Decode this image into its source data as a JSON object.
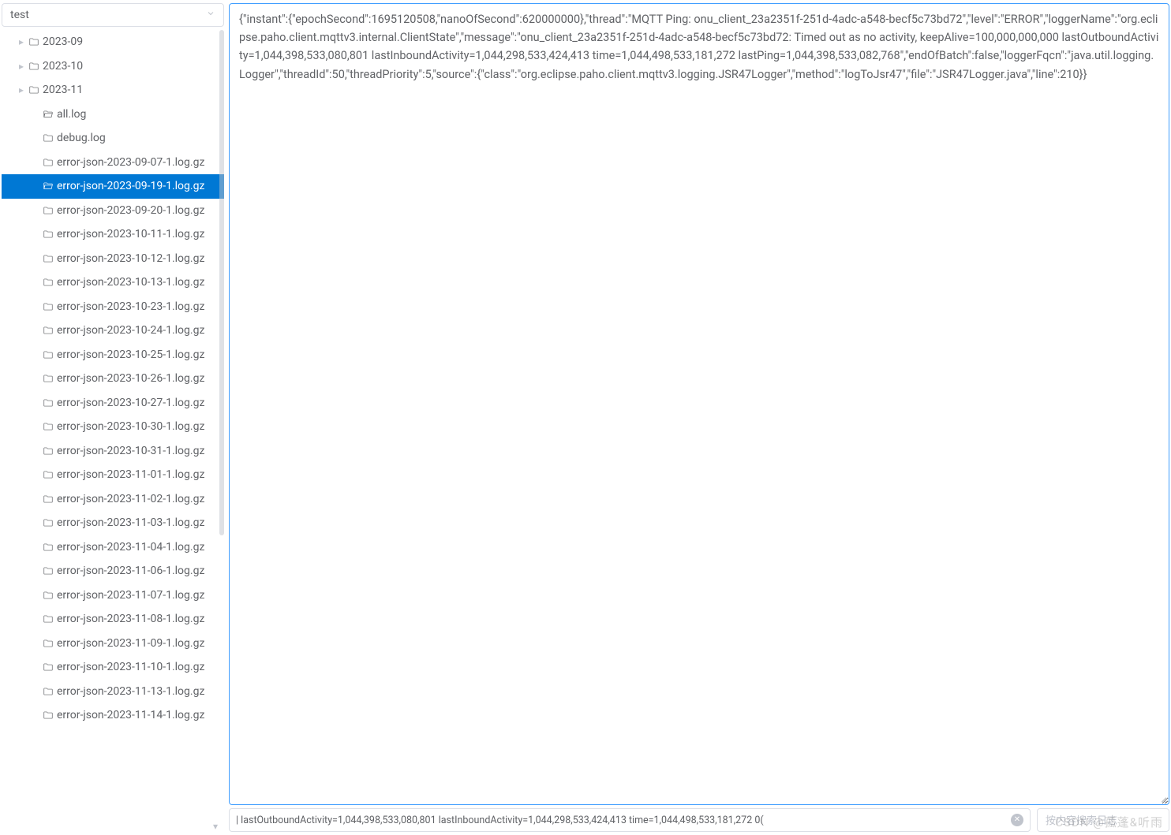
{
  "sidebar": {
    "select_value": "test",
    "folders": [
      {
        "label": "2023-09",
        "expandable": true
      },
      {
        "label": "2023-10",
        "expandable": true
      },
      {
        "label": "2023-11",
        "expandable": true
      }
    ],
    "files": [
      {
        "label": "all.log",
        "open": true
      },
      {
        "label": "debug.log",
        "open": false
      },
      {
        "label": "error-json-2023-09-07-1.log.gz",
        "open": false
      },
      {
        "label": "error-json-2023-09-19-1.log.gz",
        "open": true,
        "selected": true
      },
      {
        "label": "error-json-2023-09-20-1.log.gz",
        "open": false
      },
      {
        "label": "error-json-2023-10-11-1.log.gz",
        "open": false
      },
      {
        "label": "error-json-2023-10-12-1.log.gz",
        "open": false
      },
      {
        "label": "error-json-2023-10-13-1.log.gz",
        "open": false
      },
      {
        "label": "error-json-2023-10-23-1.log.gz",
        "open": false
      },
      {
        "label": "error-json-2023-10-24-1.log.gz",
        "open": false
      },
      {
        "label": "error-json-2023-10-25-1.log.gz",
        "open": false
      },
      {
        "label": "error-json-2023-10-26-1.log.gz",
        "open": false
      },
      {
        "label": "error-json-2023-10-27-1.log.gz",
        "open": false
      },
      {
        "label": "error-json-2023-10-30-1.log.gz",
        "open": false
      },
      {
        "label": "error-json-2023-10-31-1.log.gz",
        "open": false
      },
      {
        "label": "error-json-2023-11-01-1.log.gz",
        "open": false
      },
      {
        "label": "error-json-2023-11-02-1.log.gz",
        "open": false
      },
      {
        "label": "error-json-2023-11-03-1.log.gz",
        "open": false
      },
      {
        "label": "error-json-2023-11-04-1.log.gz",
        "open": false
      },
      {
        "label": "error-json-2023-11-06-1.log.gz",
        "open": false
      },
      {
        "label": "error-json-2023-11-07-1.log.gz",
        "open": false
      },
      {
        "label": "error-json-2023-11-08-1.log.gz",
        "open": false
      },
      {
        "label": "error-json-2023-11-09-1.log.gz",
        "open": false
      },
      {
        "label": "error-json-2023-11-10-1.log.gz",
        "open": false
      },
      {
        "label": "error-json-2023-11-13-1.log.gz",
        "open": false
      },
      {
        "label": "error-json-2023-11-14-1.log.gz",
        "open": false
      }
    ]
  },
  "main": {
    "log_text": "{\"instant\":{\"epochSecond\":1695120508,\"nanoOfSecond\":620000000},\"thread\":\"MQTT Ping: onu_client_23a2351f-251d-4adc-a548-becf5c73bd72\",\"level\":\"ERROR\",\"loggerName\":\"org.eclipse.paho.client.mqttv3.internal.ClientState\",\"message\":\"onu_client_23a2351f-251d-4adc-a548-becf5c73bd72: Timed out as no activity, keepAlive=100,000,000,000 lastOutboundActivity=1,044,398,533,080,801 lastInboundActivity=1,044,298,533,424,413 time=1,044,498,533,181,272 lastPing=1,044,398,533,082,768\",\"endOfBatch\":false,\"loggerFqcn\":\"java.util.logging.Logger\",\"threadId\":50,\"threadPriority\":5,\"source\":{\"class\":\"org.eclipse.paho.client.mqttv3.logging.JSR47Logger\",\"method\":\"logToJsr47\",\"file\":\"JSR47Logger.java\",\"line\":210}}",
    "search_current_tail": ")0 lastOutboundActivity=1,044,398,533,080,801 lastInboundActivity=1,044,298,533,424,413 time=1,044,498,533,181,272 |",
    "search_placeholder": "按内容搜索日志"
  },
  "watermark": "CSDN @孤蓬&听雨"
}
